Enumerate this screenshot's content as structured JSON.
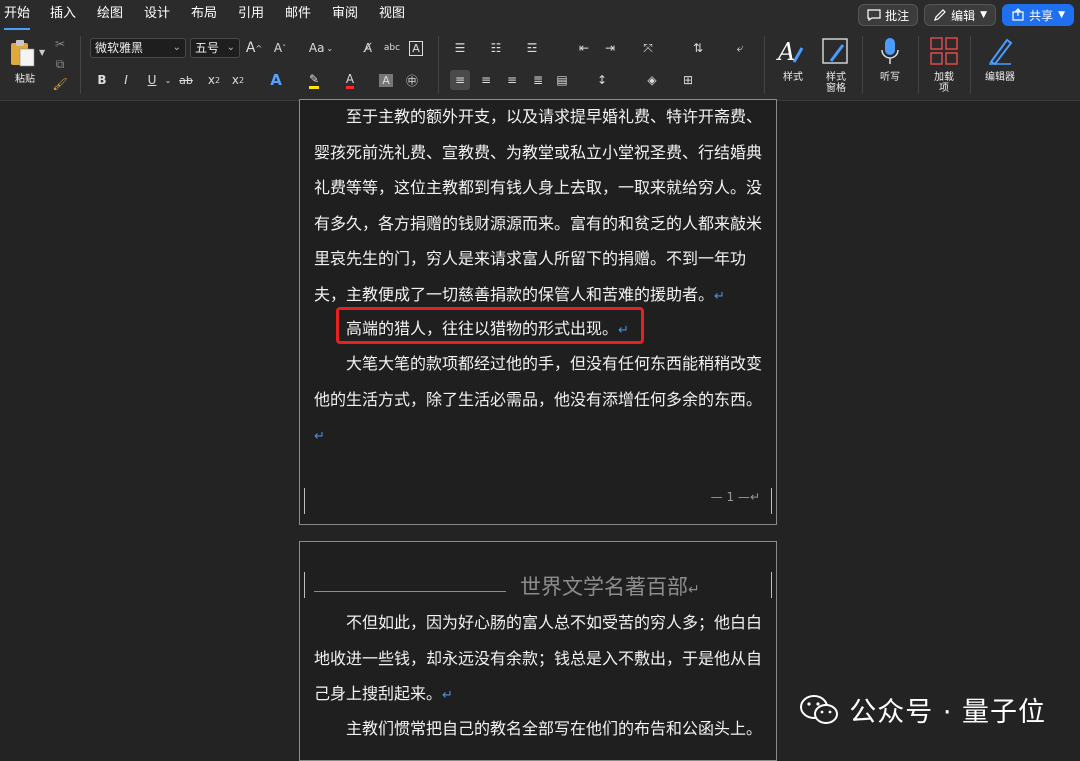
{
  "menu": {
    "tabs": [
      "开始",
      "插入",
      "绘图",
      "设计",
      "布局",
      "引用",
      "邮件",
      "审阅",
      "视图"
    ],
    "comment_label": "批注",
    "edit_label": "编辑",
    "share_label": "共享"
  },
  "ribbon": {
    "paste_label": "粘贴",
    "font_name": "微软雅黑",
    "font_size": "五号",
    "grow_font": "A",
    "shrink_font": "A",
    "change_case": "Aa",
    "bold": "B",
    "italic": "I",
    "underline": "U",
    "strike": "ab",
    "subscript": "x",
    "superscript": "x",
    "styles_label": "样式",
    "styles_pane_label": "样式\n窗格",
    "dictate_label": "听写",
    "addins_label": "加载\n项",
    "editor_label": "编辑器"
  },
  "document": {
    "page1": {
      "para1": "至于主教的额外开支，以及请求提早婚礼费、特许开斋费、婴孩死前洗礼费、宣教费、为教堂或私立小堂祝圣费、行结婚典礼费等等，这位主教都到有钱人身上去取，一取来就给穷人。没有多久，各方捐赠的钱财源源而来。富有的和贫乏的人都来敲米里哀先生的门，穷人是来请求富人所留下的捐赠。不到一年功夫，主教便成了一切慈善捐款的保管人和苦难的援助者。",
      "para2": "高端的猎人，往往以猎物的形式出现。",
      "para3": "大笔大笔的款项都经过他的手，但没有任何东西能稍稍改变他的生活方式，除了生活必需品，他没有添增任何多余的东西。",
      "footer": "— 1 —"
    },
    "page2": {
      "header_title": "世界文学名著百部",
      "para1": "不但如此，因为好心肠的富人总不如受苦的穷人多；他白白地收进一些钱，却永远没有余款；钱总是入不敷出，于是他从自己身上搜刮起来。",
      "para2": "主教们惯常把自己的教名全部写在他们的布告和公函头上。"
    },
    "return_mark": "↵"
  },
  "watermark": "公众号 · 量子位",
  "colors": {
    "accent": "#1f6ff1",
    "highlight_box": "#e52222",
    "return_mark": "#4a8fe0"
  }
}
